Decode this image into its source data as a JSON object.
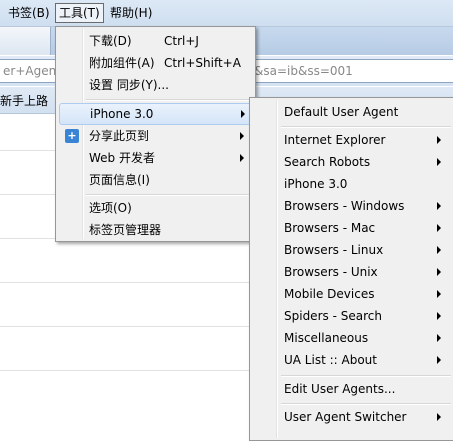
{
  "menubar": {
    "bookmarks": "书签(B)",
    "tools": "工具(T)",
    "help": "帮助(H)"
  },
  "url": {
    "left": "er+Agent",
    "right": "&sa=ib&ss=001"
  },
  "bookmarks_bar": {
    "item": "新手上路"
  },
  "tools_menu": {
    "downloads": "下载(D)",
    "downloads_shortcut": "Ctrl+J",
    "addons": "附加组件(A)",
    "addons_shortcut": "Ctrl+Shift+A",
    "sync": "设置 同步(Y)...",
    "iphone": "iPhone 3.0",
    "share": "分享此页到",
    "web_dev": "Web 开发者",
    "page_info": "页面信息(I)",
    "options": "选项(O)",
    "tab_manager": "标签页管理器"
  },
  "submenu": {
    "items": [
      "Default User Agent",
      "Internet Explorer",
      "Search Robots",
      "iPhone 3.0",
      "Browsers - Windows",
      "Browsers - Mac",
      "Browsers - Linux",
      "Browsers - Unix",
      "Mobile Devices",
      "Spiders - Search",
      "Miscellaneous",
      "UA List :: About",
      "Edit User Agents...",
      "User Agent Switcher"
    ]
  }
}
